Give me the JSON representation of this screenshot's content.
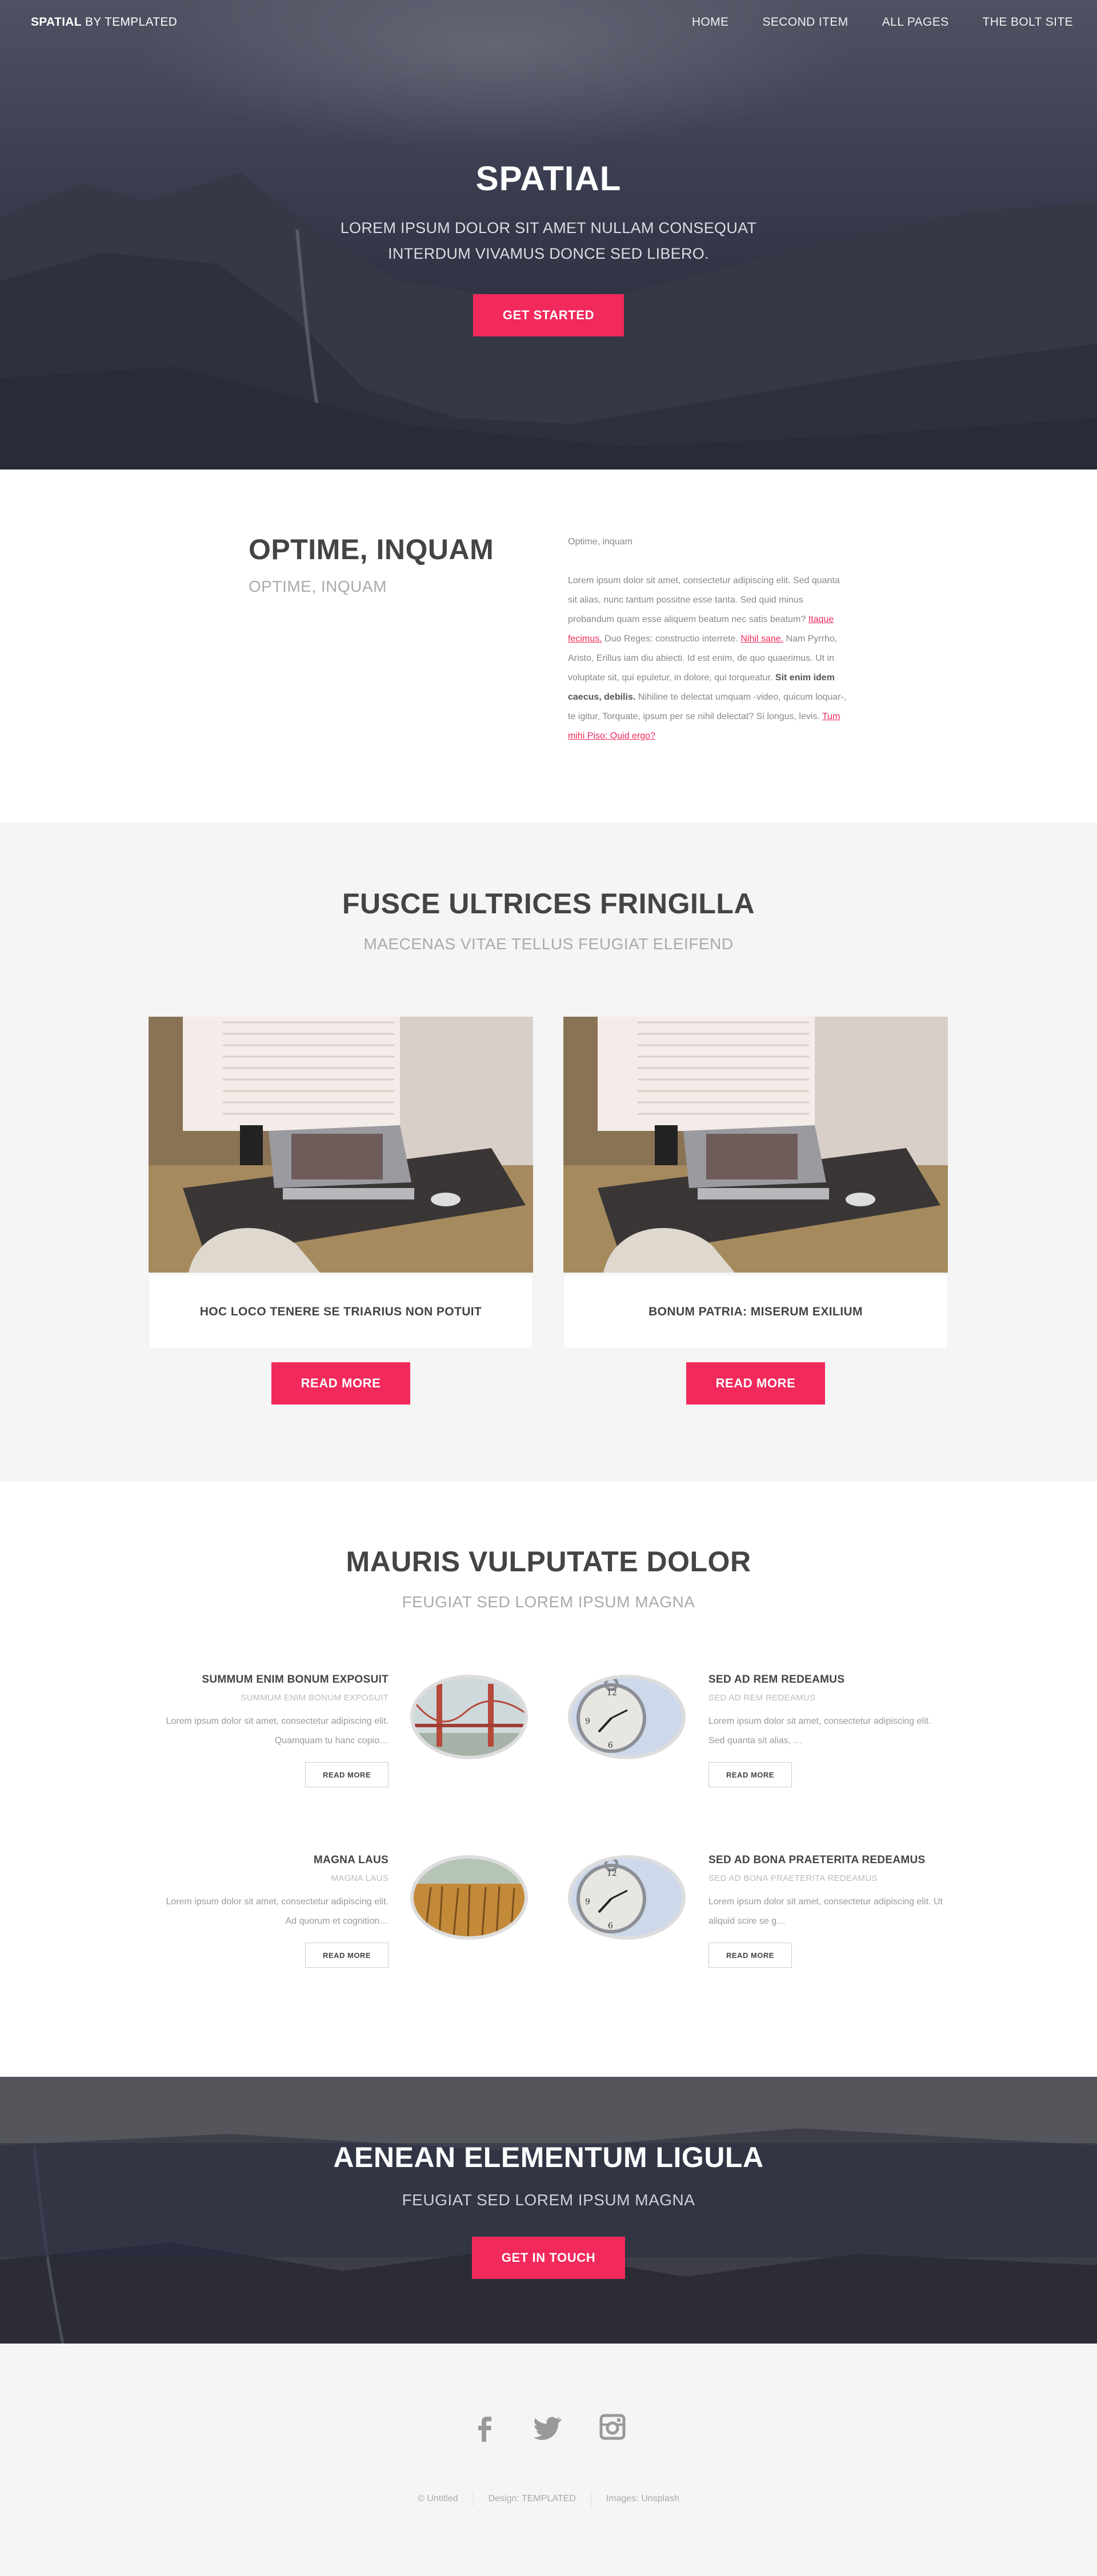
{
  "header": {
    "brand_bold": "SPATIAL",
    "brand_rest": " BY TEMPLATED",
    "nav": [
      "HOME",
      "SECOND ITEM",
      "ALL PAGES",
      "THE BOLT SITE"
    ]
  },
  "hero": {
    "title": "SPATIAL",
    "subtitle": "LOREM IPSUM DOLOR SIT AMET NULLAM CONSEQUAT INTERDUM VIVAMUS DONCE SED LIBERO.",
    "button": "GET STARTED"
  },
  "intro": {
    "title": "OPTIME, INQUAM",
    "subtitle": "OPTIME, INQUAM",
    "small_heading": "Optime, inquam",
    "p1": "Lorem ipsum dolor sit amet, consectetur adipiscing elit. Sed quanta sit alias, nunc tantum possitne esse tanta. Sed quid minus probandum quam esse aliquem beatum nec satis beatum? ",
    "link1": "Itaque fecimus.",
    "p2": " Duo Reges: constructio interrete. ",
    "link2": "Nihil sane.",
    "p3": " Nam Pyrrho, Aristo, Erillus iam diu abiecti. Id est enim, de quo quaerimus. Ut in voluptate sit, qui epuletur, in dolore, qui torqueatur. ",
    "bold": "Sit enim idem caecus, debilis.",
    "p4": " Nihiline te delectat umquam -video, quicum loquar-, te igitur, Torquate, ipsum per se nihil delectat? Si longus, levis. ",
    "link3": "Tum mihi Piso: Quid ergo?"
  },
  "fusce": {
    "title": "FUSCE ULTRICES FRINGILLA",
    "subtitle": "MAECENAS VITAE TELLUS FEUGIAT ELEIFEND",
    "cards": [
      {
        "caption": "HOC LOCO TENERE SE TRIARIUS NON POTUIT",
        "button": "READ MORE"
      },
      {
        "caption": "BONUM PATRIA: MISERUM EXILIUM",
        "button": "READ MORE"
      }
    ]
  },
  "mauris": {
    "title": "MAURIS VULPUTATE DOLOR",
    "subtitle": "FEUGIAT SED LOREM IPSUM MAGNA",
    "features": [
      {
        "heading": "SUMMUM ENIM BONUM EXPOSUIT",
        "subheading": "SUMMUM ENIM BONUM EXPOSUIT",
        "text": "Lorem ipsum dolor sit amet, consectetur adipiscing elit. Quamquam tu hanc copio…",
        "button": "READ MORE",
        "image": "golden-gate-bridge"
      },
      {
        "heading": "SED AD REM REDEAMUS",
        "subheading": "SED AD REM REDEAMUS",
        "text": "Lorem ipsum dolor sit amet, consectetur adipiscing elit. Sed quanta sit alias, …",
        "button": "READ MORE",
        "image": "pocket-watch"
      },
      {
        "heading": "MAGNA LAUS",
        "subheading": "MAGNA LAUS",
        "text": "Lorem ipsum dolor sit amet, consectetur adipiscing elit. Ad quorum et cognition…",
        "button": "READ MORE",
        "image": "wheat-field"
      },
      {
        "heading": "SED AD BONA PRAETERITA REDEAMUS",
        "subheading": "SED AD BONA PRAETERITA REDEAMUS",
        "text": "Lorem ipsum dolor sit amet, consectetur adipiscing elit. Ut aliquid scire se g…",
        "button": "READ MORE",
        "image": "pocket-watch"
      }
    ]
  },
  "cta": {
    "title": "AENEAN ELEMENTUM LIGULA",
    "subtitle": "FEUGIAT SED LOREM IPSUM MAGNA",
    "button": "GET IN TOUCH"
  },
  "footer": {
    "icons": [
      "facebook-icon",
      "twitter-icon",
      "instagram-icon"
    ],
    "copyright": [
      "© Untitled",
      "Design: TEMPLATED",
      "Images: Unsplash"
    ]
  },
  "colors": {
    "accent": "#f2295b",
    "heading": "#444444",
    "muted": "#aaaaaa",
    "section_gray": "#f5f5f5"
  }
}
